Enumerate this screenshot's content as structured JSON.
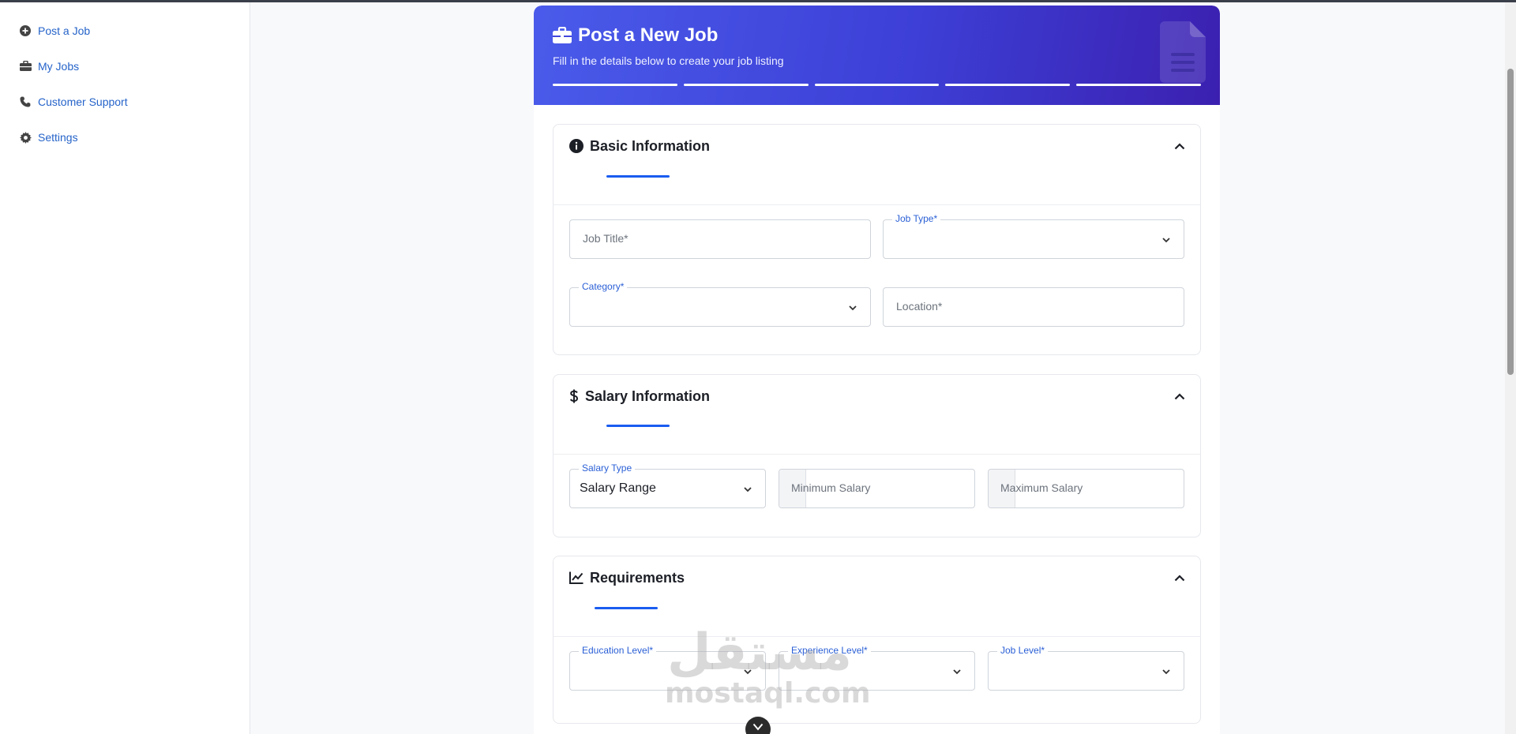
{
  "sidebar": {
    "items": [
      {
        "label": "Post a Job",
        "icon": "plus-circle-icon"
      },
      {
        "label": "My Jobs",
        "icon": "briefcase-icon"
      },
      {
        "label": "Customer Support",
        "icon": "phone-icon"
      },
      {
        "label": "Settings",
        "icon": "gear-icon"
      }
    ]
  },
  "hero": {
    "title": "Post a New Job",
    "subtitle": "Fill in the details below to create your job listing",
    "icon": "briefcase-icon",
    "decor_icon": "document-icon"
  },
  "sections": {
    "basic": {
      "title": "Basic Information",
      "icon": "info-circle-icon",
      "fields": {
        "job_title": {
          "placeholder": "Job Title*"
        },
        "job_type": {
          "label": "Job Type*",
          "value": ""
        },
        "category": {
          "label": "Category*",
          "value": ""
        },
        "location": {
          "placeholder": "Location*"
        }
      }
    },
    "salary": {
      "title": "Salary Information",
      "icon": "dollar-icon",
      "fields": {
        "salary_type": {
          "label": "Salary Type",
          "value": "Salary Range"
        },
        "min_salary": {
          "placeholder": "Minimum Salary"
        },
        "max_salary": {
          "placeholder": "Maximum Salary"
        }
      }
    },
    "requirements": {
      "title": "Requirements",
      "icon": "chart-line-icon",
      "fields": {
        "education": {
          "label": "Education Level*",
          "value": ""
        },
        "experience": {
          "label": "Experience Level*",
          "value": ""
        },
        "job_level": {
          "label": "Job Level*",
          "value": ""
        }
      }
    }
  },
  "watermark": {
    "arabic": "مستقل",
    "latin": "mostaql.com"
  },
  "colors": {
    "accent": "#1a5cf0",
    "link": "#2563c9",
    "hero_start": "#4a5bea",
    "hero_end": "#3b20b0"
  }
}
